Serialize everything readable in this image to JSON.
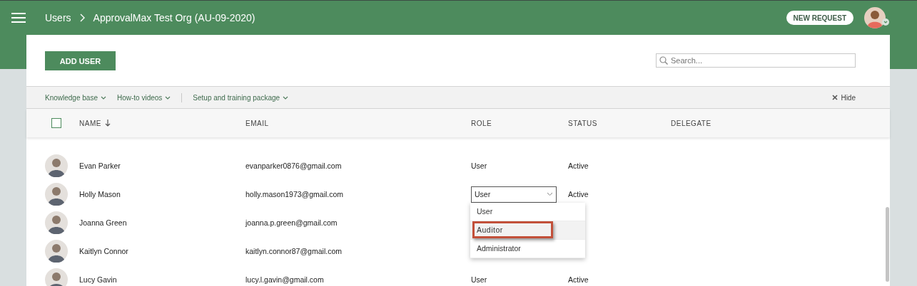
{
  "topbar": {
    "breadcrumb": [
      "Users",
      "ApprovalMax Test Org (AU-09-2020)"
    ],
    "new_request": "NEW REQUEST"
  },
  "toolbar": {
    "add_user": "ADD USER",
    "search": {
      "placeholder": "Search..."
    }
  },
  "link_groups": [
    [
      {
        "label": "Knowledge base"
      },
      {
        "label": "How-to videos"
      }
    ],
    [
      {
        "label": "Setup and training package"
      }
    ]
  ],
  "hide": "Hide",
  "table": {
    "select_all_checked": false,
    "columns": [
      {
        "label": "NAME",
        "sorted": true
      },
      {
        "label": "EMAIL",
        "sorted": false
      },
      {
        "label": "ROLE",
        "sorted": false
      },
      {
        "label": "STATUS",
        "sorted": false
      },
      {
        "label": "DELEGATE",
        "sorted": false
      }
    ],
    "rows": [
      {
        "name": "Evan Parker",
        "email": "evanparker0876@gmail.com",
        "role": "User",
        "status": "Active"
      },
      {
        "name": "Holly Mason",
        "email": "holly.mason1973@gmail.com",
        "role": "User",
        "status": "Active",
        "role_menu": {
          "options": [
            {
              "label": "User",
              "highlighted": false,
              "annotated": false
            },
            {
              "label": "Auditor",
              "highlighted": true,
              "annotated": true
            },
            {
              "label": "Administrator",
              "highlighted": false,
              "annotated": false
            }
          ]
        }
      },
      {
        "name": "Joanna Green",
        "email": "joanna.p.green@gmail.com"
      },
      {
        "name": "Kaitlyn Connor",
        "email": "kaitlyn.connor87@gmail.com"
      },
      {
        "name": "Lucy Gavin",
        "email": "lucy.l.gavin@gmail.com",
        "role": "User",
        "status": "Active"
      }
    ]
  }
}
